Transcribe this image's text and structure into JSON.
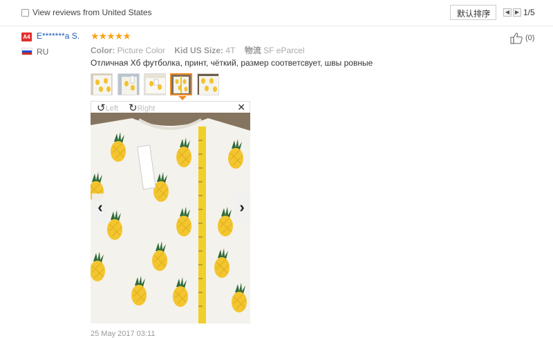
{
  "filter": {
    "label": "View reviews from United States"
  },
  "sort": {
    "label": "默认排序"
  },
  "pagination": {
    "text": "1/5"
  },
  "review": {
    "badge": "A4",
    "username": "E*******a S.",
    "rating": 5,
    "stars": "★★★★★",
    "country": "RU",
    "likes": "(0)",
    "color_label": "Color:",
    "color_value": "Picture Color",
    "size_label": "Kid US Size:",
    "size_value": "4T",
    "ship_label": "物流",
    "ship_value": "SF eParcel",
    "text": "Отличная Хб футболка, принт, чёткий, размер соответсвует, швы ровные",
    "date": "25 May 2017 03:11"
  },
  "viewer": {
    "rotate_left": "Left",
    "rotate_right": "Right",
    "selected_index": 3
  },
  "colors": {
    "accent": "#f08a24",
    "star": "#f7a41c",
    "link": "#1e5db8",
    "badge": "#e0302f"
  }
}
